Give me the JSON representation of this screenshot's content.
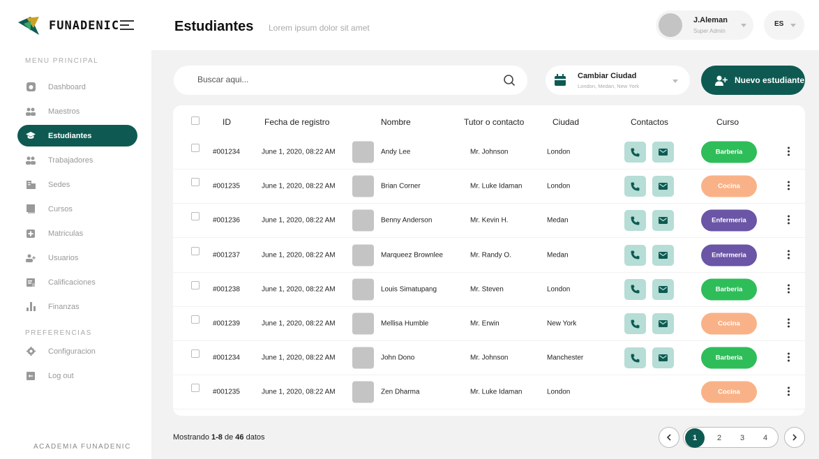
{
  "brand": {
    "name": "FUNADENIC",
    "footer": "ACADEMIA FUNADENIC"
  },
  "header": {
    "title": "Estudiantes",
    "subtitle": "Lorem ipsum  dolor sit amet"
  },
  "user": {
    "name": "J.Aleman",
    "role": "Super Admin",
    "language": "ES"
  },
  "sidebar": {
    "menu_label": "MENU PRINCIPAL",
    "items": [
      {
        "label": "Dashboard",
        "icon": "dashboard-icon"
      },
      {
        "label": "Maestros",
        "icon": "users-icon"
      },
      {
        "label": "Estudiantes",
        "icon": "graduation-cap-icon",
        "active": true
      },
      {
        "label": "Trabajadores",
        "icon": "users-icon"
      },
      {
        "label": "Sedes",
        "icon": "building-icon"
      },
      {
        "label": "Cursos",
        "icon": "book-icon"
      },
      {
        "label": "Matriculas",
        "icon": "plus-box-icon"
      },
      {
        "label": "Usuarios",
        "icon": "user-add-icon"
      },
      {
        "label": "Calificaciones",
        "icon": "grades-icon"
      },
      {
        "label": "Finanzas",
        "icon": "bar-chart-icon"
      }
    ],
    "prefs_label": "PREFERENCIAS",
    "prefs": [
      {
        "label": "Configuracion",
        "icon": "gear-icon"
      },
      {
        "label": "Log out",
        "icon": "logout-icon"
      }
    ]
  },
  "search": {
    "placeholder": "Buscar aqui..."
  },
  "city_filter": {
    "title": "Cambiar Ciudad",
    "options": "London, Medan, New York"
  },
  "new_button": {
    "label": "Nuevo estudiante"
  },
  "table": {
    "headers": [
      "ID",
      "Fecha de registro",
      "Nombre",
      "Tutor o contacto",
      "Ciudad",
      "Contactos",
      "Curso"
    ],
    "rows": [
      {
        "id": "#001234",
        "date": "June 1, 2020, 08:22 AM",
        "name": "Andy Lee",
        "tutor": "Mr. Johnson",
        "city": "London",
        "course": "Barberia",
        "contacts": true
      },
      {
        "id": "#001235",
        "date": "June 1, 2020, 08:22 AM",
        "name": "Brian Corner",
        "tutor": "Mr. Luke Idaman",
        "city": "London",
        "course": "Cocina",
        "contacts": true
      },
      {
        "id": "#001236",
        "date": "June 1, 2020, 08:22 AM",
        "name": "Benny Anderson",
        "tutor": "Mr. Kevin H.",
        "city": "Medan",
        "course": "Enfermeria",
        "contacts": true
      },
      {
        "id": "#001237",
        "date": "June 1, 2020, 08:22 AM",
        "name": "Marqueez Brownlee",
        "tutor": "Mr. Randy O.",
        "city": "Medan",
        "course": "Enfermeria",
        "contacts": true
      },
      {
        "id": "#001238",
        "date": "June 1, 2020, 08:22 AM",
        "name": "Louis Simatupang",
        "tutor": "Mr. Steven",
        "city": "London",
        "course": "Barberia",
        "contacts": true
      },
      {
        "id": "#001239",
        "date": "June 1, 2020, 08:22 AM",
        "name": "Mellisa Humble",
        "tutor": "Mr. Erwin",
        "city": "New York",
        "course": "Cocina",
        "contacts": true
      },
      {
        "id": "#001234",
        "date": "June 1, 2020, 08:22 AM",
        "name": "John Dono",
        "tutor": "Mr. Johnson",
        "city": "Manchester",
        "course": "Barberia",
        "contacts": true
      },
      {
        "id": "#001235",
        "date": "June 1, 2020, 08:22 AM",
        "name": "Zen Dharma",
        "tutor": "Mr. Luke Idaman",
        "city": "London",
        "course": "Cocina",
        "contacts": false
      }
    ]
  },
  "course_colors": {
    "Barberia": "#2ebd59",
    "Cocina": "#f9b287",
    "Enfermeria": "#6a55a6"
  },
  "colors": {
    "accent": "#0e5a52",
    "contact_bg": "#b6ddd6"
  },
  "pagination": {
    "showing_prefix": "Mostrando ",
    "range": "1-8",
    "of": " de ",
    "total": "46",
    "suffix": " datos",
    "pages": [
      "1",
      "2",
      "3",
      "4"
    ],
    "current": "1"
  }
}
